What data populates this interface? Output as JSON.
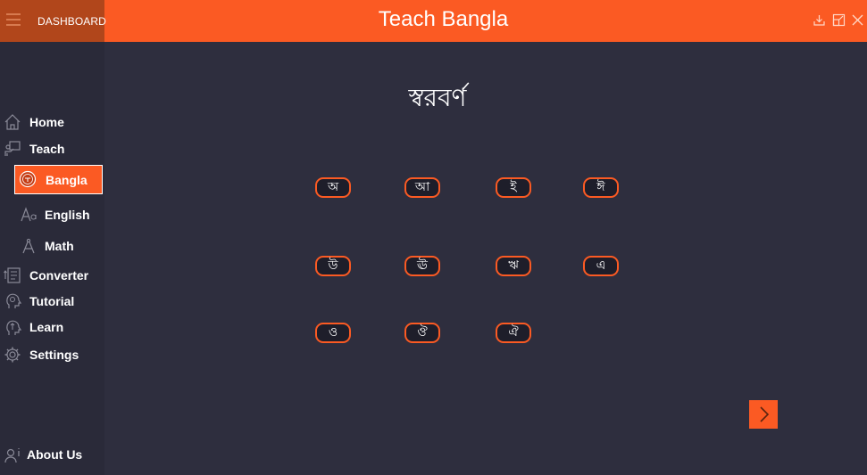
{
  "header": {
    "dashboard_label": "DASHBOARD",
    "app_title": "Teach Bangla",
    "accent_color": "#fb5a23"
  },
  "sidebar": {
    "items": [
      {
        "label": "Home",
        "icon": "home-icon"
      },
      {
        "label": "Teach",
        "icon": "teach-icon"
      },
      {
        "label": "Bangla",
        "icon": "bangla-logo-icon",
        "active": true
      },
      {
        "label": "English",
        "icon": "font-icon"
      },
      {
        "label": "Math",
        "icon": "compass-icon"
      },
      {
        "label": "Converter",
        "icon": "converter-icon"
      },
      {
        "label": "Tutorial",
        "icon": "bulb-head-icon"
      },
      {
        "label": "Learn",
        "icon": "head-arrow-icon"
      },
      {
        "label": "Settings",
        "icon": "gear-icon"
      }
    ],
    "about": {
      "label": "About Us",
      "icon": "user-info-icon"
    }
  },
  "main": {
    "heading": "স্বরবর্ণ",
    "letters": [
      "অ",
      "আ",
      "ই",
      "ঈ",
      "উ",
      "ঊ",
      "ঋ",
      "এ",
      "ও",
      "ঔ",
      "ঐ"
    ]
  }
}
